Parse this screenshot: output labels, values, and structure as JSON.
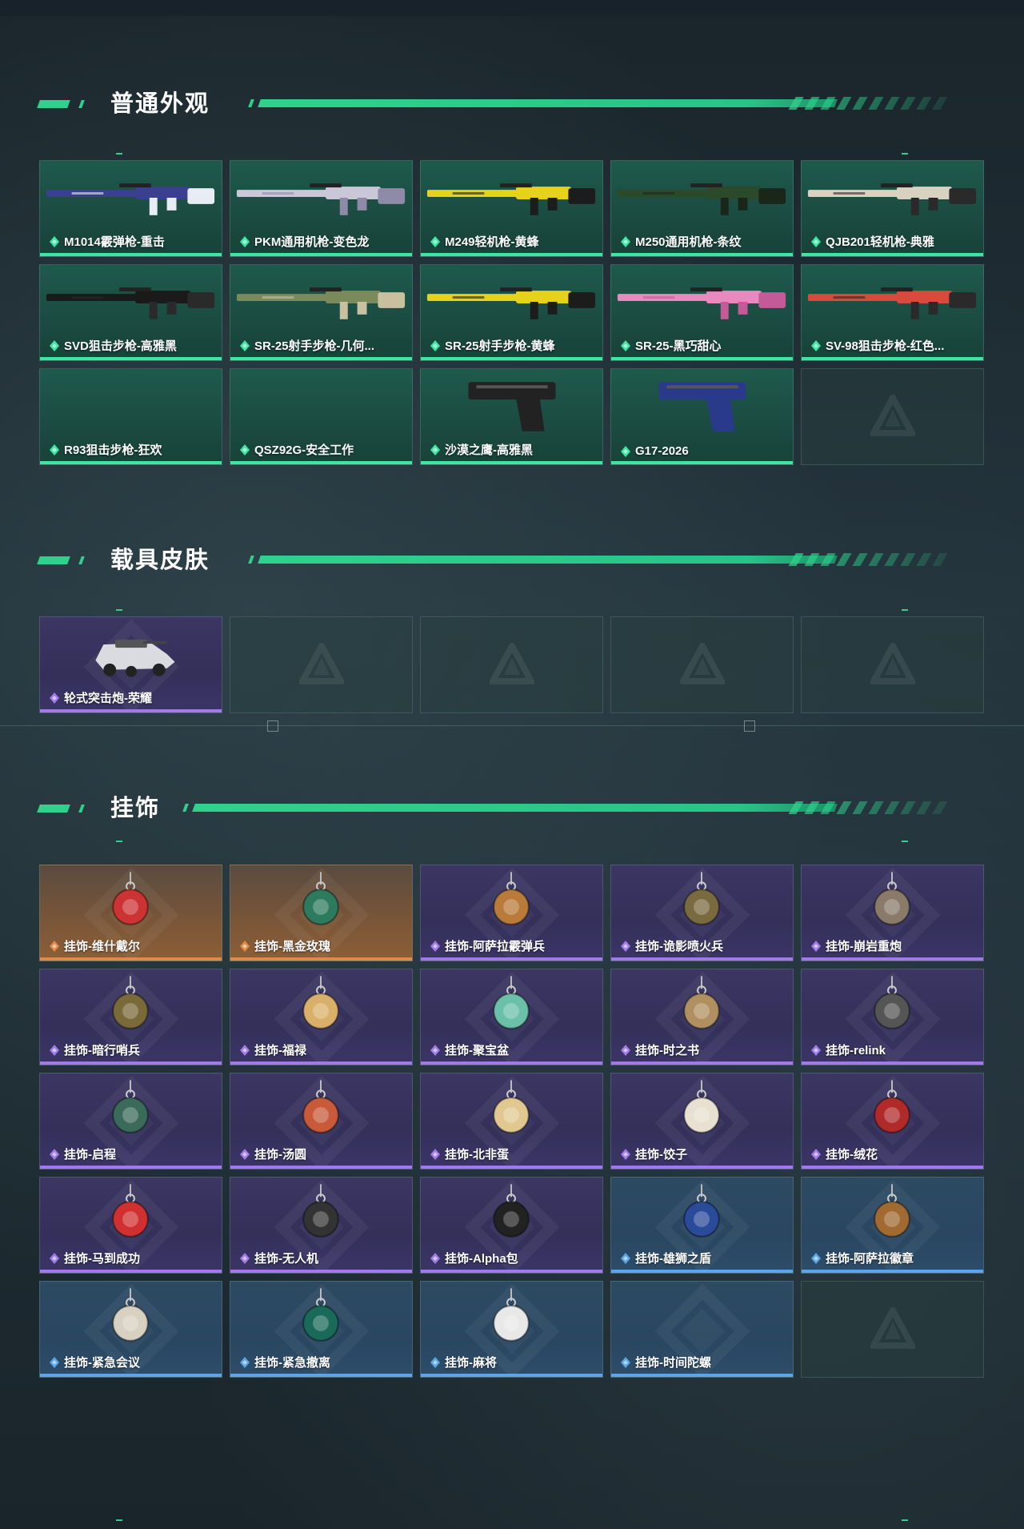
{
  "theme": {
    "accent": "#2fd28c",
    "green_rarity": "#3ee6a4",
    "purple_rarity": "#a07ae8",
    "orange_rarity": "#e08a45",
    "blue_rarity": "#5aa6e8"
  },
  "sections": [
    {
      "title": "普通外观",
      "items": [
        {
          "label": "M1014霰弹枪-重击",
          "rarity": "green",
          "icon": "shotgun-skin-image"
        },
        {
          "label": "PKM通用机枪-变色龙",
          "rarity": "green",
          "icon": "machine-gun-skin-image"
        },
        {
          "label": "M249轻机枪-黄蜂",
          "rarity": "green",
          "icon": "light-machine-gun-skin-image"
        },
        {
          "label": "M250通用机枪-条纹",
          "rarity": "green",
          "icon": "machine-gun-skin-image"
        },
        {
          "label": "QJB201轻机枪-典雅",
          "rarity": "green",
          "icon": "light-machine-gun-skin-image"
        },
        {
          "label": "SVD狙击步枪-高雅黑",
          "rarity": "green",
          "icon": "sniper-rifle-skin-image"
        },
        {
          "label": "SR-25射手步枪-几何...",
          "rarity": "green",
          "icon": "marksman-rifle-skin-image"
        },
        {
          "label": "SR-25射手步枪-黄蜂",
          "rarity": "green",
          "icon": "marksman-rifle-skin-image"
        },
        {
          "label": "SR-25-黑巧甜心",
          "rarity": "green",
          "icon": "marksman-rifle-skin-image"
        },
        {
          "label": "SV-98狙击步枪-红色...",
          "rarity": "green",
          "icon": "sniper-rifle-skin-image"
        },
        {
          "label": "R93狙击步枪-狂欢",
          "rarity": "green",
          "icon": "none"
        },
        {
          "label": "QSZ92G-安全工作",
          "rarity": "green",
          "icon": "none"
        },
        {
          "label": "沙漠之鹰-高雅黑",
          "rarity": "green",
          "icon": "pistol-skin-image"
        },
        {
          "label": "G17-2026",
          "rarity": "green",
          "icon": "pistol-skin-image"
        }
      ]
    },
    {
      "title": "载具皮肤",
      "items": [
        {
          "label": "轮式突击炮-荣耀",
          "rarity": "purple",
          "icon": "vehicle-skin-image"
        }
      ]
    },
    {
      "title": "挂饰",
      "items": [
        {
          "label": "挂饰-维什戴尔",
          "rarity": "orange",
          "icon": "charm-image"
        },
        {
          "label": "挂饰-黑金玫瑰",
          "rarity": "orange",
          "icon": "charm-image"
        },
        {
          "label": "挂饰-阿萨拉霰弹兵",
          "rarity": "purple",
          "icon": "charm-image"
        },
        {
          "label": "挂饰-诡影喷火兵",
          "rarity": "purple",
          "icon": "charm-image"
        },
        {
          "label": "挂饰-崩岩重炮",
          "rarity": "purple",
          "icon": "charm-image"
        },
        {
          "label": "挂饰-暗行哨兵",
          "rarity": "purple",
          "icon": "charm-image"
        },
        {
          "label": "挂饰-福禄",
          "rarity": "purple",
          "icon": "charm-image"
        },
        {
          "label": "挂饰-聚宝盆",
          "rarity": "purple",
          "icon": "charm-image"
        },
        {
          "label": "挂饰-时之书",
          "rarity": "purple",
          "icon": "charm-image"
        },
        {
          "label": "挂饰-relink",
          "rarity": "purple",
          "icon": "charm-image"
        },
        {
          "label": "挂饰-启程",
          "rarity": "purple",
          "icon": "charm-image"
        },
        {
          "label": "挂饰-汤圆",
          "rarity": "purple",
          "icon": "charm-image"
        },
        {
          "label": "挂饰-北非蛋",
          "rarity": "purple",
          "icon": "charm-image"
        },
        {
          "label": "挂饰-饺子",
          "rarity": "purple",
          "icon": "charm-image"
        },
        {
          "label": "挂饰-绒花",
          "rarity": "purple",
          "icon": "charm-image"
        },
        {
          "label": "挂饰-马到成功",
          "rarity": "purple",
          "icon": "charm-image"
        },
        {
          "label": "挂饰-无人机",
          "rarity": "purple",
          "icon": "charm-image"
        },
        {
          "label": "挂饰-Alpha包",
          "rarity": "purple",
          "icon": "charm-image"
        },
        {
          "label": "挂饰-雄狮之盾",
          "rarity": "blue",
          "icon": "charm-image"
        },
        {
          "label": "挂饰-阿萨拉徽章",
          "rarity": "blue",
          "icon": "charm-image"
        },
        {
          "label": "挂饰-紧急会议",
          "rarity": "blue",
          "icon": "charm-image"
        },
        {
          "label": "挂饰-紧急撤离",
          "rarity": "blue",
          "icon": "charm-image"
        },
        {
          "label": "挂饰-麻将",
          "rarity": "blue",
          "icon": "charm-image"
        },
        {
          "label": "挂饰-时间陀螺",
          "rarity": "blue",
          "icon": "none"
        }
      ]
    }
  ]
}
